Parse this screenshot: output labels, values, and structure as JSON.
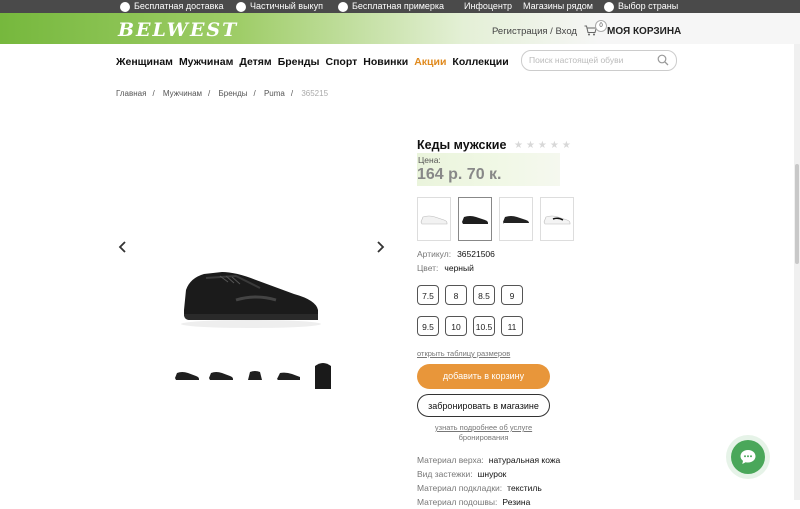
{
  "topbar": {
    "items": [
      {
        "label": "Бесплатная доставка",
        "icon": "truck-icon"
      },
      {
        "label": "Частичный выкуп",
        "icon": "wallet-icon"
      },
      {
        "label": "Бесплатная примерка",
        "icon": "hanger-icon"
      },
      {
        "label": "Инфоцентр"
      },
      {
        "label": "Магазины рядом"
      },
      {
        "label": "Выбор страны",
        "icon": "globe-icon"
      }
    ]
  },
  "header": {
    "logo": "BELWEST",
    "auth_link": "Регистрация / Вход",
    "cart_count": "0",
    "cart_label": "МОЯ КОРЗИНА"
  },
  "nav": {
    "items": [
      "Женщинам",
      "Мужчинам",
      "Детям",
      "Бренды",
      "Спорт",
      "Новинки",
      "Акции",
      "Коллекции"
    ]
  },
  "search": {
    "placeholder": "Поиск настоящей обуви"
  },
  "breadcrumb": [
    "Главная",
    "Мужчинам",
    "Бренды",
    "Puma",
    "365215"
  ],
  "product": {
    "title": "Кеды мужские",
    "stars": "★★★★★",
    "price_label": "Цена:",
    "price": "164 р. 70 к.",
    "sku_label": "Артикул:",
    "sku": "36521506",
    "color_label": "Цвет:",
    "color": "черный",
    "sizes": [
      "7.5",
      "8",
      "8.5",
      "9",
      "9.5",
      "10",
      "10.5",
      "11"
    ],
    "size_table_link": "открыть таблицу размеров",
    "add_to_cart": "добавить в корзину",
    "reserve": "забронировать в магазине",
    "reserve_info_line1": "узнать подробнее об услуге",
    "reserve_info_line2": "бронирования",
    "attributes": [
      {
        "label": "Материал верха:",
        "value": "натуральная кожа"
      },
      {
        "label": "Вид застежки:",
        "value": "шнурок"
      },
      {
        "label": "Материал подкладки:",
        "value": "текстиль"
      },
      {
        "label": "Материал подошвы:",
        "value": "Резина"
      }
    ]
  },
  "colors": {
    "accent": "#e8963a",
    "brand_green": "#76b83d",
    "topbar": "#4a4a4a",
    "chat": "#4aa75a"
  }
}
